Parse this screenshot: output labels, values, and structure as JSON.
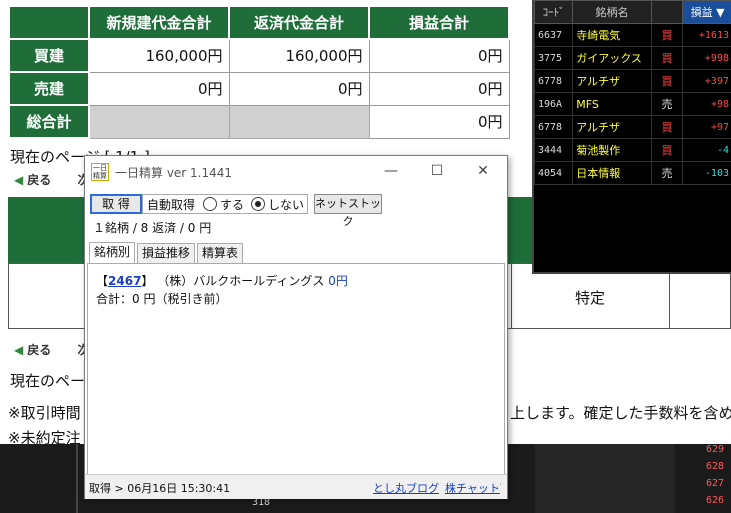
{
  "summary": {
    "headers": [
      "新規建代金合計",
      "返済代金合計",
      "損益合計"
    ],
    "rows": [
      {
        "label": "買建",
        "values": [
          "160,000円",
          "160,000円",
          "0円"
        ]
      },
      {
        "label": "売建",
        "values": [
          "0円",
          "0円",
          "0円"
        ]
      },
      {
        "label": "総合計",
        "values": [
          "",
          "",
          "0円"
        ]
      }
    ]
  },
  "page": {
    "current_page": "現在のページ [ 1/1 ]",
    "back": "戻る",
    "next": "次",
    "current_page2": "現在のペー",
    "note1_left": "※取引時間",
    "note1_right": "上します。確定した手数料を含め",
    "note2": "※未約定注",
    "tokutei": "特定"
  },
  "stock_panel": {
    "headers": {
      "code": "ｺｰﾄﾞ",
      "name": "銘柄名",
      "pl": "損益"
    },
    "rows": [
      {
        "code": "6637",
        "name": "寺崎電気",
        "side": "買",
        "pl": "+1613",
        "sign": "pos"
      },
      {
        "code": "3775",
        "name": "ガイアックス",
        "side": "買",
        "pl": "+998",
        "sign": "pos"
      },
      {
        "code": "6778",
        "name": "アルチザ",
        "side": "買",
        "pl": "+397",
        "sign": "pos"
      },
      {
        "code": "196A",
        "name": "MFS",
        "side": "売",
        "pl": "+98",
        "sign": "pos"
      },
      {
        "code": "6778",
        "name": "アルチザ",
        "side": "買",
        "pl": "+97",
        "sign": "pos"
      },
      {
        "code": "3444",
        "name": "菊池製作",
        "side": "買",
        "pl": "-4",
        "sign": "neg"
      },
      {
        "code": "4054",
        "name": "日本情報",
        "side": "売",
        "pl": "-103",
        "sign": "neg"
      }
    ]
  },
  "dialog": {
    "icon_text": "一日精算",
    "title": "一日精算 ver 1.1441",
    "fetch_button": "取 得",
    "auto_fetch_label": "自動取得",
    "radio_on": "する",
    "radio_off": "しない",
    "netstock_button": "ネットストック",
    "counts": "１銘柄 / 8 返済 / 0 円",
    "tabs": [
      "銘柄別",
      "損益推移",
      "精算表"
    ],
    "entry_code": "2467",
    "entry_name": "（株）バルクホールディングス",
    "entry_amount": "0円",
    "total": "合計：0 円（税引き前）",
    "status": "取得 > 06月16日 15:30:41",
    "link_blog": "とし丸ブログ",
    "link_chart": "株チャット"
  },
  "background_numbers": {
    "bottom_value": "318",
    "right_prices": [
      "629",
      "628",
      "627",
      "626"
    ]
  }
}
